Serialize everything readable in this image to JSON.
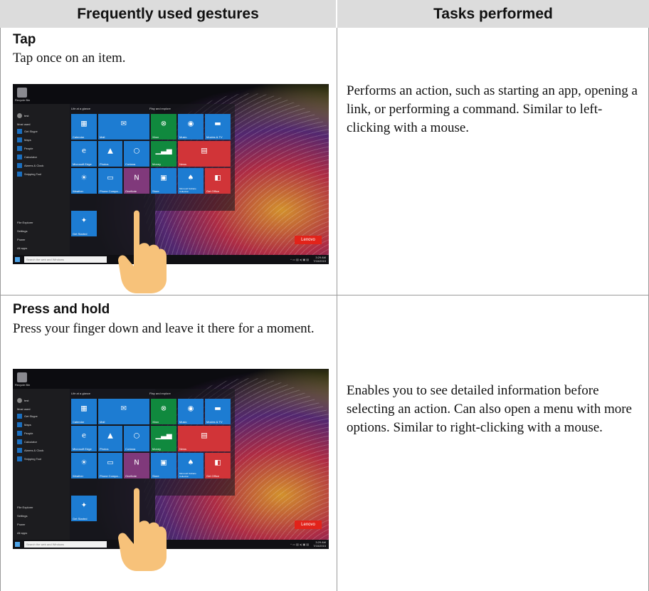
{
  "header": {
    "left": "Frequently used gestures",
    "right": "Tasks performed"
  },
  "rows": [
    {
      "title": "Tap",
      "description": "Tap once on an item.",
      "task": "Performs an action, such as starting an app, opening a link, or performing a command. Similar to left-clicking with a mouse."
    },
    {
      "title": "Press and hold",
      "description": "Press your finger down and leave it there for a moment.",
      "task": "Enables you to see detailed information before selecting an action. Can also open a menu with more options. Similar to right-clicking with a mouse."
    }
  ],
  "screenshot": {
    "recycle_bin": "Recycle Bin",
    "user": "test",
    "most_used": "Most used",
    "start_items": [
      "Get Skype",
      "Maps",
      "People",
      "Calculator",
      "Alarms & Clock",
      "Snipping Tool"
    ],
    "bottom_items": [
      "File Explorer",
      "Settings",
      "Power",
      "All apps"
    ],
    "group_life": "Life at a glance",
    "group_play": "Play and explore",
    "tiles": [
      "Calendar",
      "Mail",
      "Xbox",
      "Music",
      "Movies & TV",
      "Microsoft Edge",
      "Photos",
      "Cortana",
      "Money",
      "News",
      "Weather",
      "Phone Compa...",
      "OneNote",
      "Store",
      "Microsoft Solitaire Collection",
      "Get Office",
      "Get Started"
    ],
    "search_placeholder": "Search the web and Windows",
    "clock_time": "3:29 AM",
    "clock_date": "7/16/2015",
    "brand": "Lenovo"
  },
  "colors": {
    "header_bg": "#dcdcdc",
    "tile_blue": "#1d7cd2",
    "tile_green": "#10893e",
    "tile_red": "#d13438",
    "tile_purple": "#80397b",
    "finger": "#f7c27a"
  }
}
